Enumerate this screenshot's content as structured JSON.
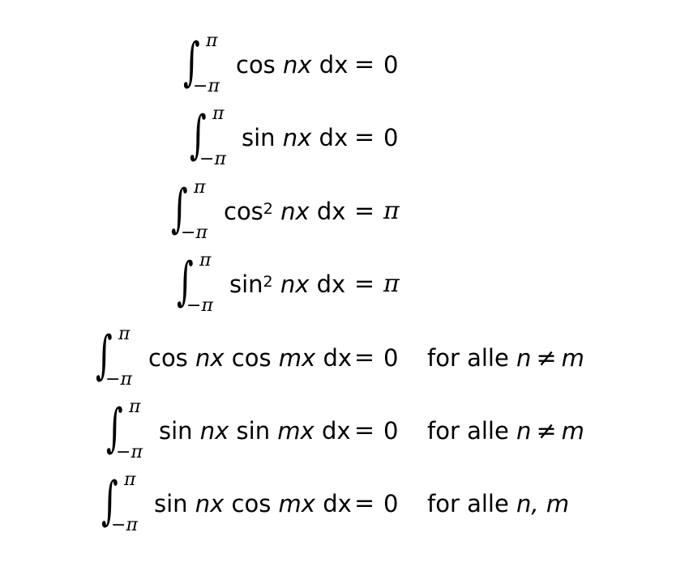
{
  "integral": {
    "sign": "∫",
    "upper": "π",
    "lower_minus": "−",
    "lower_pi": "π"
  },
  "equations": [
    {
      "func1": "cos",
      "power1": "",
      "arg1": "nx",
      "func2": "",
      "arg2": "",
      "dx": "dx",
      "equals": "=",
      "result": "0",
      "condition_prefix": "",
      "condition_vars": ""
    },
    {
      "func1": "sin",
      "power1": "",
      "arg1": "nx",
      "func2": "",
      "arg2": "",
      "dx": "dx",
      "equals": "=",
      "result": "0",
      "condition_prefix": "",
      "condition_vars": ""
    },
    {
      "func1": "cos",
      "power1": "2",
      "arg1": "nx",
      "func2": "",
      "arg2": "",
      "dx": "dx",
      "equals": "=",
      "result": "π",
      "condition_prefix": "",
      "condition_vars": ""
    },
    {
      "func1": "sin",
      "power1": "2",
      "arg1": "nx",
      "func2": "",
      "arg2": "",
      "dx": "dx",
      "equals": "=",
      "result": "π",
      "condition_prefix": "",
      "condition_vars": ""
    },
    {
      "func1": "cos",
      "power1": "",
      "arg1": "nx",
      "func2": "cos",
      "arg2": "mx",
      "dx": "dx",
      "equals": "=",
      "result": "0",
      "condition_prefix": "for alle",
      "condition_n": "n",
      "condition_rel": "≠",
      "condition_m": "m"
    },
    {
      "func1": "sin",
      "power1": "",
      "arg1": "nx",
      "func2": "sin",
      "arg2": "mx",
      "dx": "dx",
      "equals": "=",
      "result": "0",
      "condition_prefix": "for alle",
      "condition_n": "n",
      "condition_rel": "≠",
      "condition_m": "m"
    },
    {
      "func1": "sin",
      "power1": "",
      "arg1": "nx",
      "func2": "cos",
      "arg2": "mx",
      "dx": "dx",
      "equals": "=",
      "result": "0",
      "condition_prefix": "for alle",
      "condition_n": "n,",
      "condition_rel": "",
      "condition_m": "m"
    }
  ]
}
